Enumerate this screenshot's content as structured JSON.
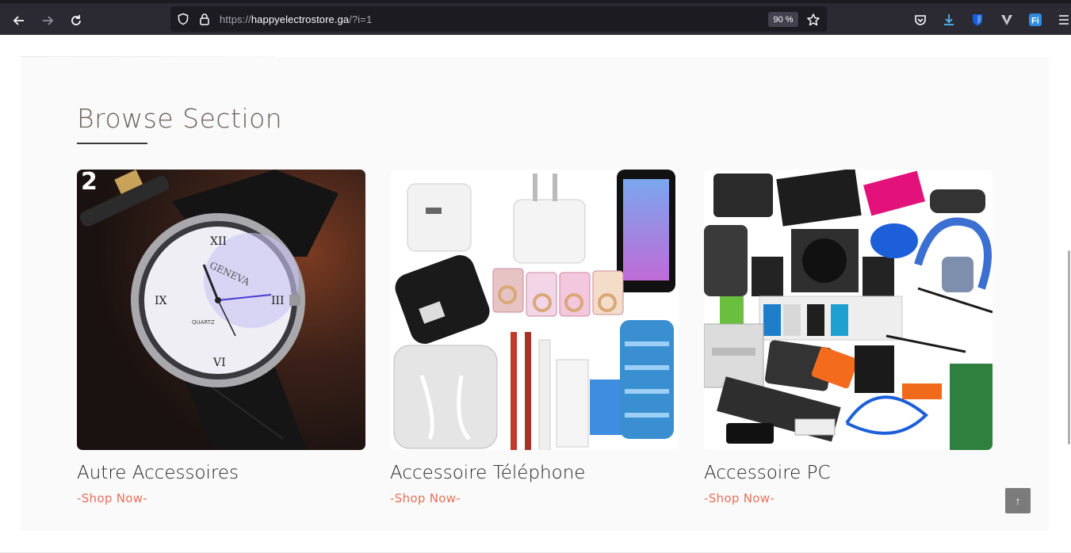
{
  "browser": {
    "url_scheme": "https://",
    "url_host": "happyelectrostore.ga",
    "url_path": "/?i=1",
    "zoom": "90 %"
  },
  "section": {
    "title": "Browse Section"
  },
  "cards": [
    {
      "title": "Autre Accessoires",
      "link": "-Shop Now-",
      "badge": "2"
    },
    {
      "title": "Accessoire Téléphone",
      "link": "-Shop Now-"
    },
    {
      "title": "Accessoire PC",
      "link": "-Shop Now-"
    }
  ],
  "back_to_top": "↑",
  "colors": {
    "accent": "#e8715a",
    "toolbar": "#2b2a33",
    "page_bg": "#fafafa"
  }
}
